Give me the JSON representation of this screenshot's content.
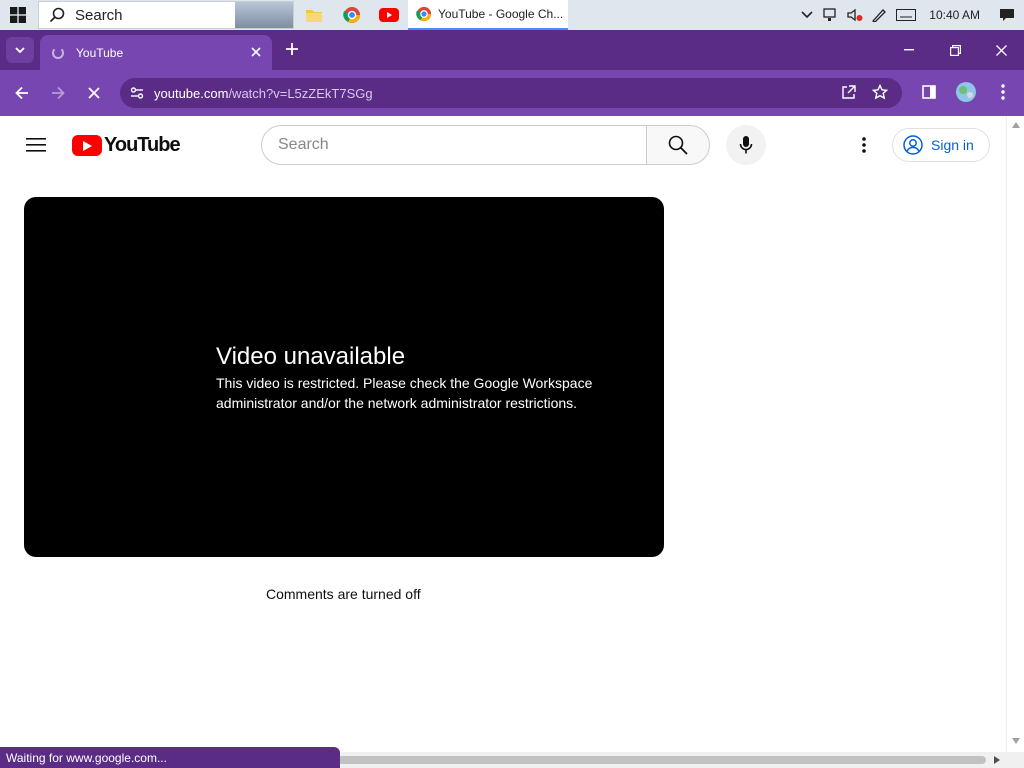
{
  "taskbar": {
    "search_label": "Search",
    "active_window_title": "YouTube - Google Ch...",
    "clock": "10:40 AM"
  },
  "browser": {
    "tab_title": "YouTube",
    "url_host": "youtube.com",
    "url_path": "/watch?v=L5zZEkT7SGg",
    "accent_color": "#7746b0",
    "tabstrip_color": "#5b2c86",
    "status_text": "Waiting for www.google.com..."
  },
  "youtube": {
    "logo_text": "YouTube",
    "search_placeholder": "Search",
    "sign_in_label": "Sign in",
    "player": {
      "heading": "Video unavailable",
      "message": "This video is restricted. Please check the Google Workspace administrator and/or the network administrator restrictions."
    },
    "comments_text": "Comments are turned off"
  }
}
